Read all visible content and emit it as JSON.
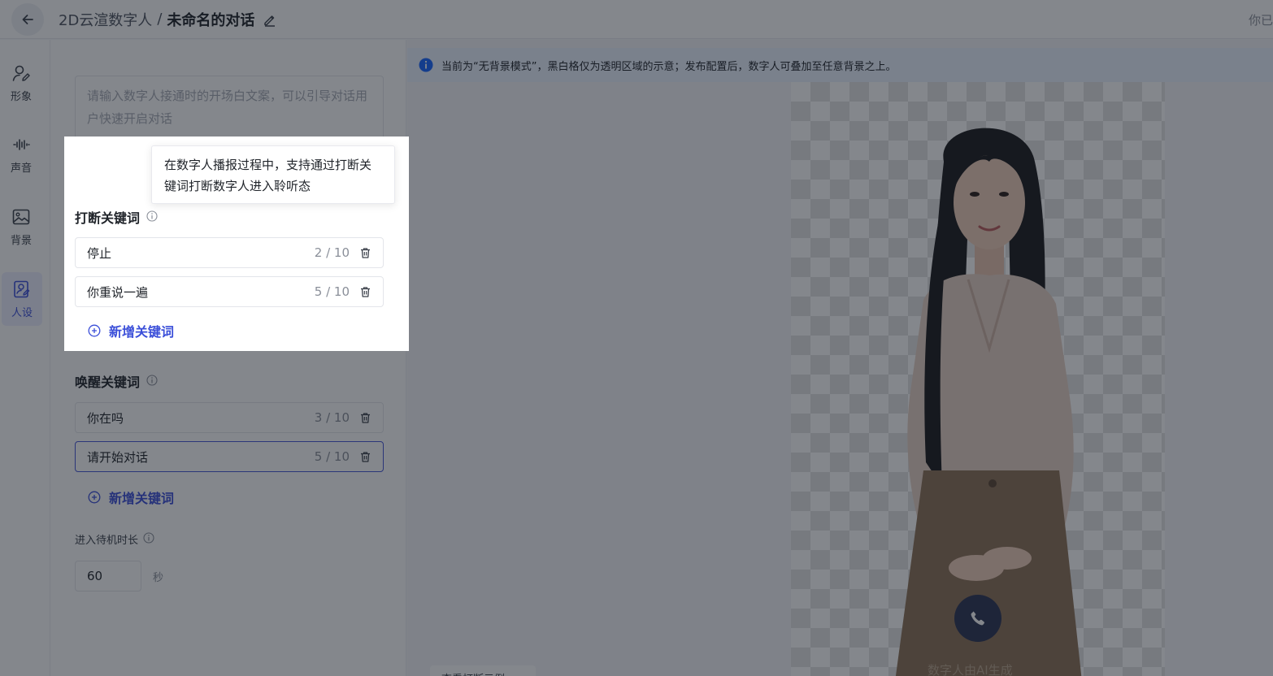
{
  "header": {
    "app_name": "2D云渲数字人",
    "separator": "/",
    "title": "未命名的对话",
    "right_text": "你已"
  },
  "sidebar": {
    "items": [
      {
        "label": "形象",
        "icon": "user-edit-icon"
      },
      {
        "label": "声音",
        "icon": "waveform-icon"
      },
      {
        "label": "背景",
        "icon": "image-icon"
      },
      {
        "label": "人设",
        "icon": "persona-icon",
        "active": true
      }
    ]
  },
  "opening": {
    "placeholder": "请输入数字人接通时的开场白文案，可以引导对话用户快速开启对话"
  },
  "interrupt": {
    "title": "打断关键词",
    "tooltip": "在数字人播报过程中，支持通过打断关键词打断数字人进入聆听态",
    "keywords": [
      {
        "text": "停止",
        "count": "2 / 10"
      },
      {
        "text": "你重说一遍",
        "count": "5 / 10"
      }
    ],
    "add_label": "新增关键词"
  },
  "wake": {
    "title": "唤醒关键词",
    "keywords": [
      {
        "text": "你在吗",
        "count": "3 / 10"
      },
      {
        "text": "请开始对话",
        "count": "5 / 10"
      }
    ],
    "add_label": "新增关键词"
  },
  "standby": {
    "label": "进入待机时长",
    "value": "60",
    "unit": "秒"
  },
  "preview": {
    "notice": "当前为“无背景模式”，黑白格仅为透明区域的示意；发布配置后，数字人可叠加至任意背景之上。",
    "watermark": "数字人由AI生成",
    "bottom_tag": "查看打断示例"
  },
  "colors": {
    "accent": "#3b4fd9",
    "overlay": "rgba(20,24,35,0.52)",
    "notice_bg": "#eaf2ff",
    "info_icon": "#1664ff"
  }
}
